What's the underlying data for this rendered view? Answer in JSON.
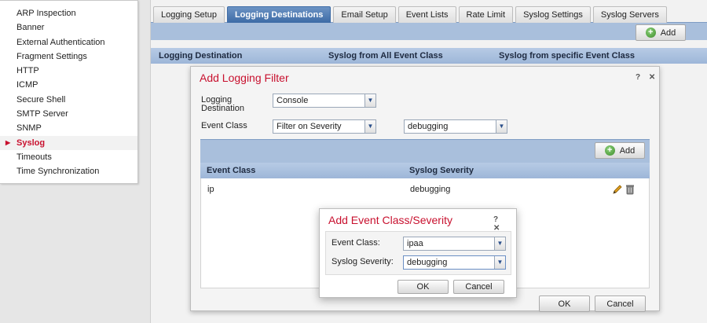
{
  "sidebar": {
    "items": [
      {
        "label": "ARP Inspection",
        "active": false
      },
      {
        "label": "Banner",
        "active": false
      },
      {
        "label": "External Authentication",
        "active": false
      },
      {
        "label": "Fragment Settings",
        "active": false
      },
      {
        "label": "HTTP",
        "active": false
      },
      {
        "label": "ICMP",
        "active": false
      },
      {
        "label": "Secure Shell",
        "active": false
      },
      {
        "label": "SMTP Server",
        "active": false
      },
      {
        "label": "SNMP",
        "active": false
      },
      {
        "label": "Syslog",
        "active": true
      },
      {
        "label": "Timeouts",
        "active": false
      },
      {
        "label": "Time Synchronization",
        "active": false
      }
    ]
  },
  "tabs": [
    {
      "label": "Logging Setup",
      "active": false
    },
    {
      "label": "Logging Destinations",
      "active": true
    },
    {
      "label": "Email Setup",
      "active": false
    },
    {
      "label": "Event Lists",
      "active": false
    },
    {
      "label": "Rate Limit",
      "active": false
    },
    {
      "label": "Syslog Settings",
      "active": false
    },
    {
      "label": "Syslog Servers",
      "active": false
    }
  ],
  "main": {
    "add_label": "Add",
    "columns": [
      "Logging Destination",
      "Syslog from All Event Class",
      "Syslog from specific Event Class"
    ]
  },
  "logging_filter": {
    "title": "Add Logging Filter",
    "controls": "? ✕",
    "destination_label": "Logging Destination",
    "destination_value": "Console",
    "event_class_label": "Event Class",
    "event_class_value": "Filter on Severity",
    "severity_value": "debugging",
    "add_label": "Add",
    "columns": [
      "Event Class",
      "Syslog Severity"
    ],
    "rows": [
      {
        "event_class": "ip",
        "severity": "debugging"
      }
    ],
    "ok_label": "OK",
    "cancel_label": "Cancel"
  },
  "event_severity_dialog": {
    "title": "Add Event Class/Severity",
    "controls": "? ✕",
    "event_class_label": "Event Class:",
    "event_class_value": "ipaa",
    "severity_label": "Syslog Severity:",
    "severity_value": "debugging",
    "ok_label": "OK",
    "cancel_label": "Cancel"
  },
  "colors": {
    "accent_red": "#c8102e",
    "tab_active": "#3d6ba6",
    "header_blue": "#9db6d8"
  }
}
